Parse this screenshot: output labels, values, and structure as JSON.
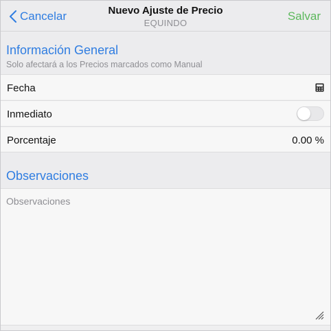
{
  "navbar": {
    "back_label": "Cancelar",
    "title": "Nuevo Ajuste de Precio",
    "subtitle": "EQUINDO",
    "save_label": "Salvar"
  },
  "general": {
    "title": "Información General",
    "subtitle": "Solo afectará a los Precios marcados como Manual",
    "fecha_label": "Fecha",
    "fecha_icon": "calculator-icon",
    "inmediato_label": "Inmediato",
    "inmediato_on": false,
    "porcentaje_label": "Porcentaje",
    "porcentaje_value": "0.00 %"
  },
  "observaciones": {
    "title": "Observaciones",
    "placeholder": "Observaciones",
    "value": ""
  },
  "colors": {
    "accent": "#2f7de1",
    "save": "#5cb85c",
    "muted": "#8e8e93"
  }
}
